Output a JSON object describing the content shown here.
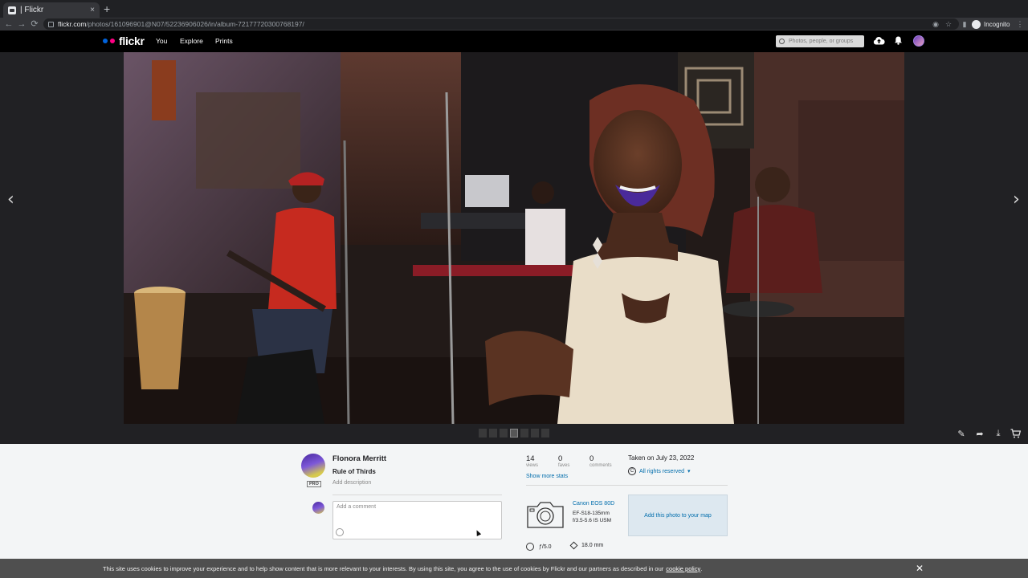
{
  "browser": {
    "tab_title": "| Flickr",
    "tab_close": "×",
    "new_tab": "+",
    "url_host": "flickr.com",
    "url_path": "/photos/161096901@N07/52236906026/in/album-72177720300768197/",
    "nav_back": "←",
    "nav_forward": "→",
    "nav_reload": "⟳",
    "incognito_label": "Incognito",
    "menu": "⋮"
  },
  "header": {
    "logo_text": "flickr",
    "nav_items": [
      "You",
      "Explore",
      "Prints"
    ],
    "search_placeholder": "Photos, people, or groups",
    "colors": {
      "dot_blue": "#0063dc",
      "dot_pink": "#ff0084"
    }
  },
  "photo_viewer": {
    "prev_arrow": "‹",
    "next_arrow": "›"
  },
  "photo_actions": {
    "edit_icon": "✎",
    "share_icon": "➦",
    "download_icon": "⤓",
    "cart_icon": "🛒"
  },
  "info": {
    "owner_name": "Flonora Merritt",
    "pro_badge": "PRO",
    "photo_title": "Rule of Thirds",
    "add_description": "Add description",
    "comment_placeholder": "Add a comment",
    "stats": [
      {
        "value": "14",
        "label": "views"
      },
      {
        "value": "0",
        "label": "faves"
      },
      {
        "value": "0",
        "label": "comments"
      }
    ],
    "show_more_stats": "Show more stats",
    "taken_on": "Taken on July 23, 2022",
    "rights_symbol": "C",
    "rights": "All rights reserved",
    "rights_caret": "▾",
    "camera_name": "Canon EOS 80D",
    "lens_line1": "EF-S18-135mm",
    "lens_line2": "f/3.5-5.6 IS USM",
    "map_cta": "Add this photo to your map",
    "aperture": "ƒ/5.0",
    "focal_length": "18.0 mm"
  },
  "cookie_banner": {
    "text": "This site uses cookies to improve your experience and to help show content that is more relevant to your interests. By using this site, you agree to the use of cookies by Flickr and our partners as described in our",
    "link": "cookie policy",
    "period": ".",
    "close": "✕"
  }
}
